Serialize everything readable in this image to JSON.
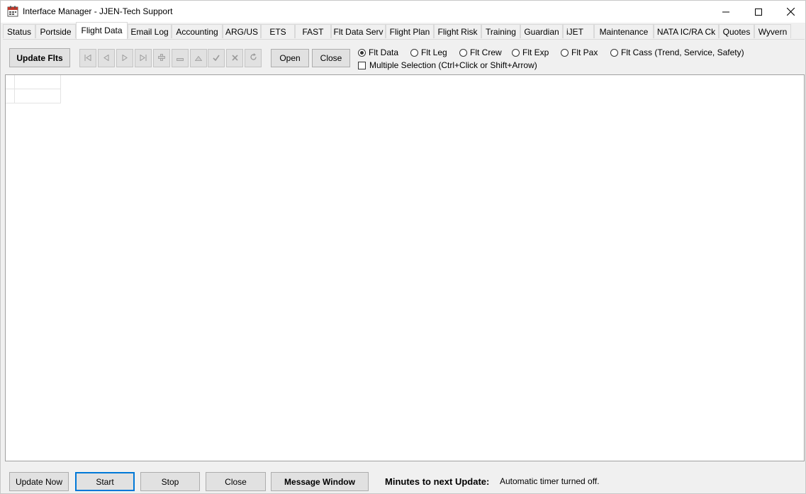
{
  "window": {
    "title": "Interface Manager - JJEN-Tech Support",
    "icon": "calendar-app-icon",
    "controls": [
      "minimize-icon",
      "maximize-icon",
      "close-icon"
    ]
  },
  "tabs": [
    {
      "label": "Status"
    },
    {
      "label": "Portside"
    },
    {
      "label": "Flight Data",
      "active": true
    },
    {
      "label": "Email Log"
    },
    {
      "label": "Accounting"
    },
    {
      "label": "ARG/US"
    },
    {
      "label": "ETS"
    },
    {
      "label": "FAST"
    },
    {
      "label": "Flt Data Serv"
    },
    {
      "label": "Flight Plan"
    },
    {
      "label": "Flight Risk"
    },
    {
      "label": "Training"
    },
    {
      "label": "Guardian"
    },
    {
      "label": "iJET"
    },
    {
      "label": "Maintenance"
    },
    {
      "label": "NATA IC/RA Ck"
    },
    {
      "label": "Quotes"
    },
    {
      "label": "Wyvern"
    }
  ],
  "toolbar": {
    "update_flts_label": "Update Flts",
    "nav_icons": [
      "first-record-icon",
      "prior-record-icon",
      "next-record-icon",
      "last-record-icon",
      "insert-record-icon",
      "delete-record-icon",
      "edit-record-icon",
      "post-record-icon",
      "cancel-record-icon",
      "refresh-record-icon"
    ],
    "open_label": "Open",
    "close_label": "Close"
  },
  "options": {
    "radios": [
      {
        "label": "Flt Data",
        "checked": true
      },
      {
        "label": "Flt Leg",
        "checked": false
      },
      {
        "label": "Flt Crew",
        "checked": false
      },
      {
        "label": "Flt Exp",
        "checked": false
      },
      {
        "label": "Flt Pax",
        "checked": false
      },
      {
        "label": "Flt Cass (Trend, Service, Safety)",
        "checked": false
      }
    ],
    "multiple_selection_label": "Multiple Selection (Ctrl+Click or Shift+Arrow)",
    "multiple_selection_checked": false
  },
  "footer": {
    "update_now_label": "Update Now",
    "start_label": "Start",
    "stop_label": "Stop",
    "close_label": "Close",
    "message_window_label": "Message Window",
    "minutes_label": "Minutes to next Update:",
    "minutes_value": "Automatic timer turned off."
  },
  "colors": {
    "accent": "#0078d7",
    "window_bg": "#f0f0f0",
    "button_bg": "#e1e1e1"
  }
}
